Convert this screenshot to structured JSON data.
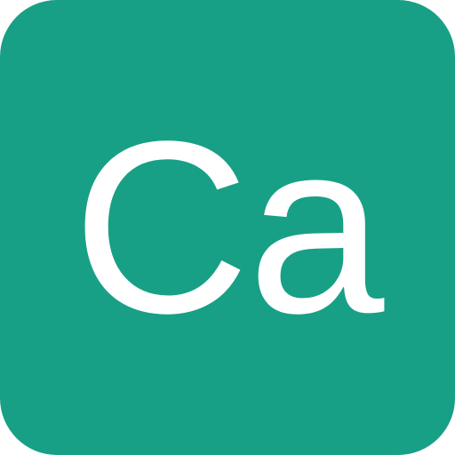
{
  "icon": {
    "symbol": "Ca",
    "background_color": "#18a086",
    "text_color": "#ffffff"
  }
}
